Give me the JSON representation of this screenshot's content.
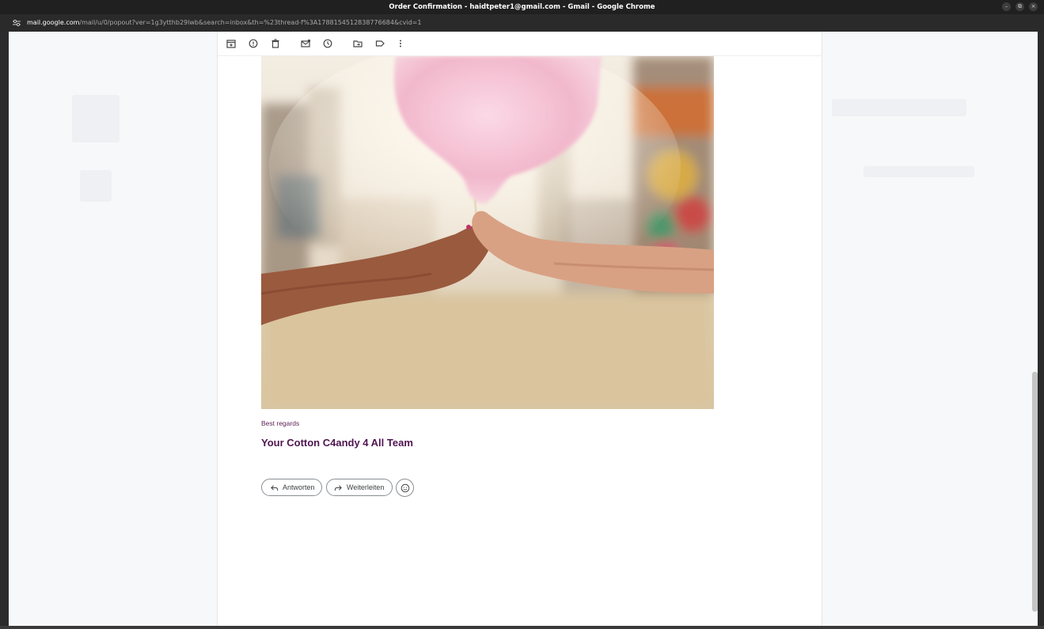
{
  "window": {
    "title": "Order Confirmation - haidtpeter1@gmail.com - Gmail - Google Chrome",
    "controls": {
      "minimize": "–",
      "maximize": "⧉",
      "close": "×"
    }
  },
  "address_bar": {
    "host": "mail.google.com",
    "path": "/mail/u/0/popout?ver=1g3ytthb29lwb&search=inbox&th=%23thread-f%3A1788154512838776684&cvid=1"
  },
  "toolbar": {
    "icons": [
      "archive-icon",
      "report-spam-icon",
      "delete-icon",
      "mark-unread-icon",
      "snooze-icon",
      "move-to-icon",
      "label-icon",
      "more-vert-icon"
    ]
  },
  "email": {
    "image_icon": "cotton-candy-photo",
    "closing": "Best regards",
    "signature": "Your Cotton C4andy 4 All Team"
  },
  "actions": {
    "reply_label": "Antworten",
    "forward_label": "Weiterleiten",
    "emoji_icon": "emoji-icon"
  },
  "colors": {
    "signature": "#4f1550",
    "closing": "#5b1f55",
    "titlebar": "#202020"
  }
}
